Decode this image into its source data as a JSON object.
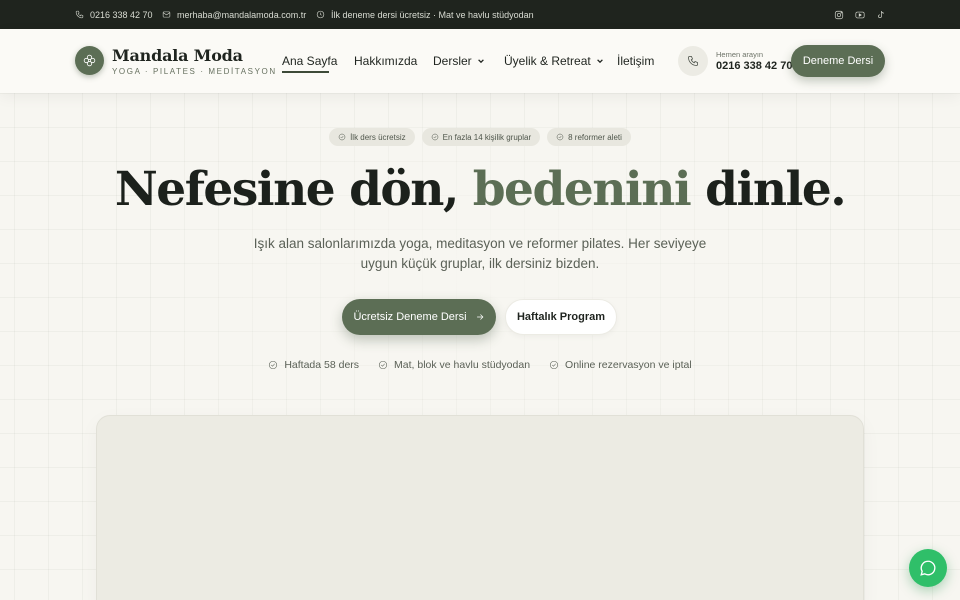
{
  "topbar": {
    "phone": "0216 338 42 70",
    "email": "merhaba@mandalamoda.com.tr",
    "notice": "İlk deneme dersi ücretsiz · Mat ve havlu stüdyodan",
    "social": [
      "instagram-icon",
      "youtube-icon",
      "tiktok-icon"
    ]
  },
  "header": {
    "brand_name": "Mandala Moda",
    "brand_tagline": "YOGA · PILATES · MEDİTASYON",
    "nav": [
      {
        "label": "Ana Sayfa",
        "active": true
      },
      {
        "label": "Hakkımızda"
      },
      {
        "label": "Dersler",
        "dropdown": true
      },
      {
        "label": "Üyelik & Retreat",
        "dropdown": true
      },
      {
        "label": "İletişim"
      }
    ],
    "call_label": "Hemen arayın",
    "call_number": "0216 338 42 70",
    "cta": "Deneme Dersi"
  },
  "hero": {
    "chips": [
      "İlk ders ücretsiz",
      "En fazla 14 kişilik gruplar",
      "8 reformer aleti"
    ],
    "title_part1": "Nefesine dön, ",
    "title_accent": "bedenini",
    "title_part2": " dinle.",
    "subtitle": "Işık alan salonlarımızda yoga, meditasyon ve reformer pilates. Her seviyeye uygun küçük gruplar, ilk dersiniz bizden.",
    "primary_button": "Ücretsiz Deneme Dersi",
    "secondary_button": "Haftalık Program",
    "features": [
      "Haftada 58 ders",
      "Mat, blok ve havlu stüdyodan",
      "Online rezervasyon ve iptal"
    ]
  },
  "colors": {
    "accent": "#5c6e55",
    "topbar_bg": "#1f241e",
    "page_bg": "#f7f6f1",
    "chat_green": "#2fbf69"
  }
}
